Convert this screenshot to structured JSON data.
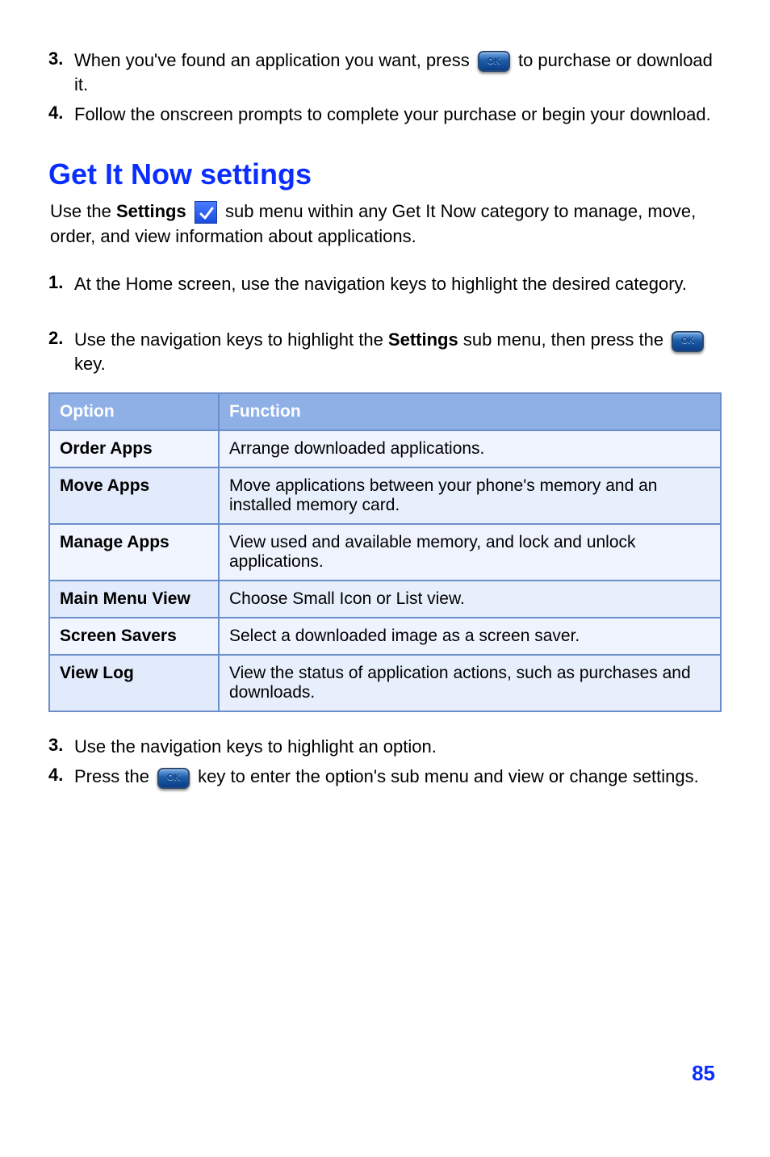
{
  "preSteps": {
    "step3": {
      "num": "3.",
      "before": "When you've found an application you want, press ",
      "after": " to purchase or download it."
    },
    "step4": {
      "num": "4.",
      "text": "Follow the onscreen prompts to complete your purchase or begin your download."
    }
  },
  "heading": "Get It Now settings",
  "headingDesc": {
    "before": "Use the ",
    "bold": "Settings",
    "after": " sub menu within any Get It Now category to manage, move, order, and view information about applications."
  },
  "steps": {
    "step1": {
      "num": "1.",
      "text": "At the Home screen, use the navigation keys to highlight the desired category."
    },
    "step2": {
      "num": "2.",
      "before": "Use the navigation keys to highlight the ",
      "bold": "Settings",
      "after": " sub menu, then press the ",
      "tail": " key."
    }
  },
  "table": {
    "headers": {
      "option": "Option",
      "function": "Function"
    },
    "rows": [
      {
        "option": "Order Apps",
        "function": "Arrange downloaded applications."
      },
      {
        "option": "Move Apps",
        "function": "Move applications between your phone's memory and an installed memory card."
      },
      {
        "option": "Manage Apps",
        "function": "View used and available memory, and lock and unlock applications."
      },
      {
        "option": "Main Menu View",
        "function": "Choose Small Icon or List view."
      },
      {
        "option": "Screen Savers",
        "function": "Select a downloaded image as a screen saver."
      },
      {
        "option": "View Log",
        "function": "View the status of application actions, such as purchases and downloads."
      }
    ]
  },
  "postSteps": {
    "step3": {
      "num": "3.",
      "text": "Use the navigation keys to highlight an option."
    },
    "step4": {
      "num": "4.",
      "before": "Press the ",
      "after": " key to enter the option's sub menu and view or change settings."
    }
  },
  "pageNumber": "85"
}
